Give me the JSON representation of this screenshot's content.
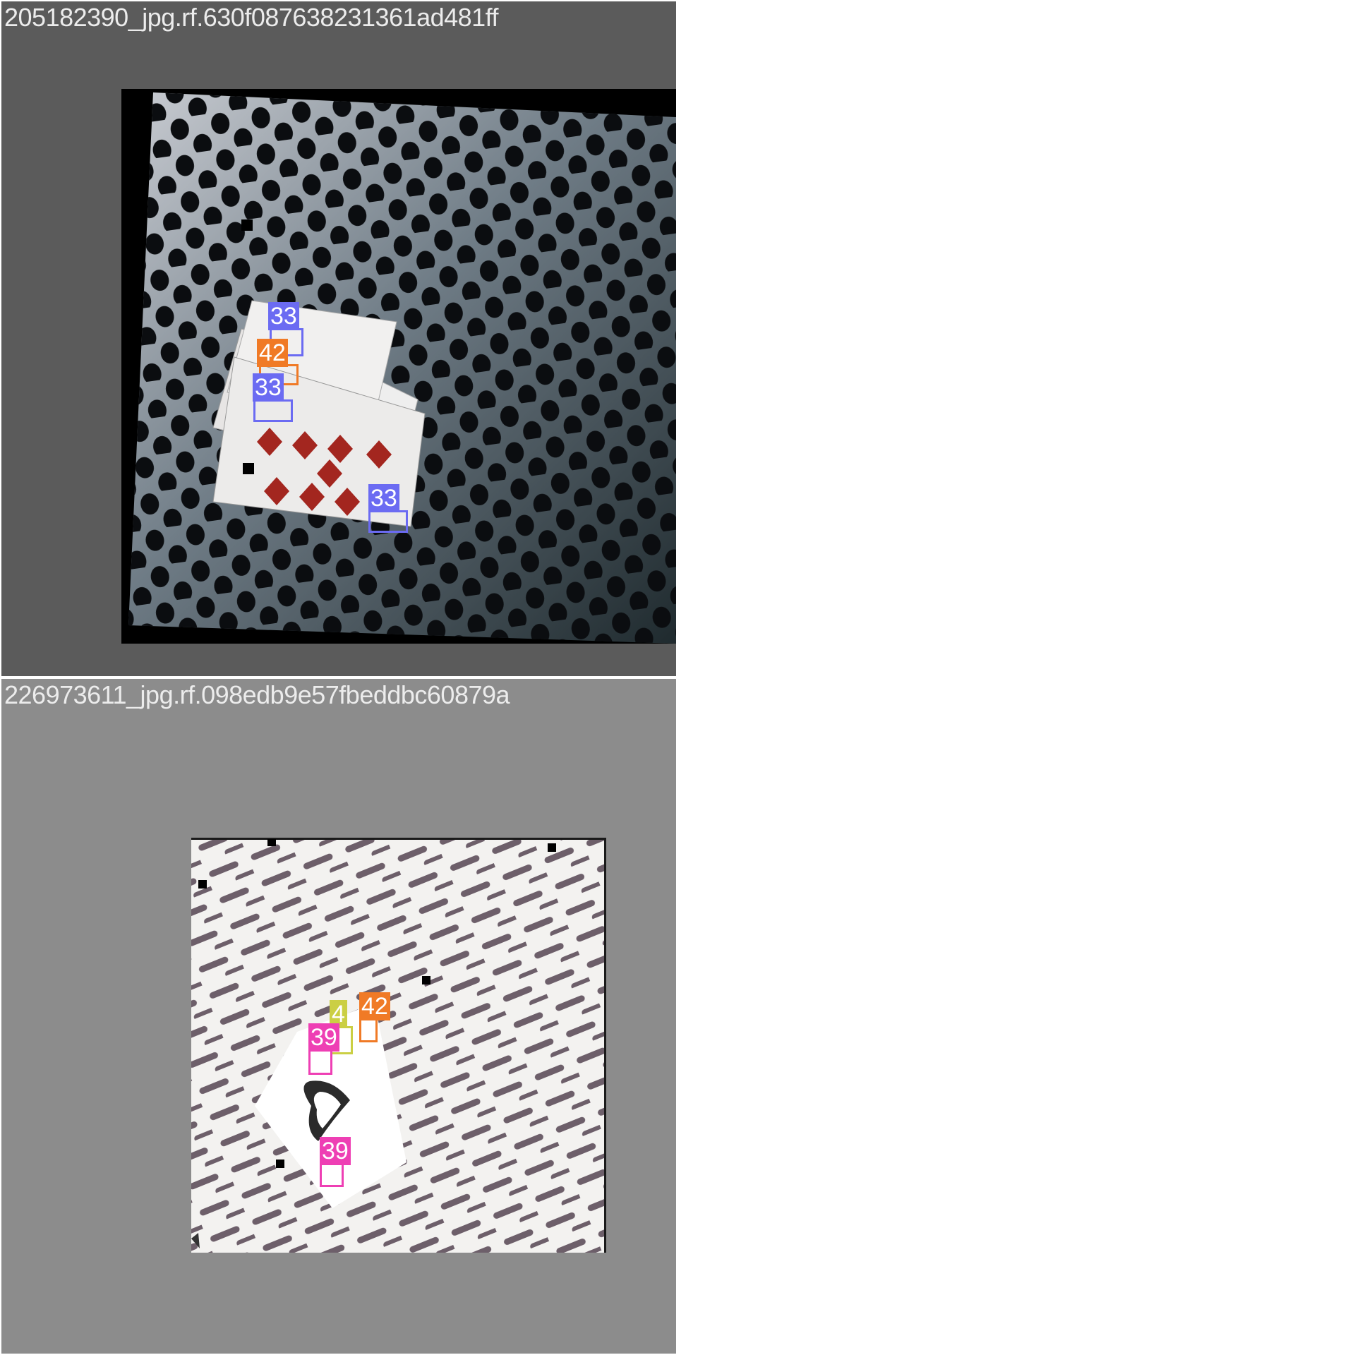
{
  "colors": {
    "class_33": "#6b6bf2",
    "class_42": "#f07a26",
    "class_39": "#ee3fb4",
    "class_4": "#cbcf44"
  },
  "tiles": [
    {
      "title": "205182390_jpg.rf.630f087638231361ad481ff",
      "labels": [
        "33",
        "42",
        "33",
        "33"
      ]
    },
    {
      "title": "226973611_jpg.rf.098edb9e57fbeddbc60879a",
      "labels": [
        "4",
        "42",
        "39",
        "39"
      ]
    }
  ]
}
